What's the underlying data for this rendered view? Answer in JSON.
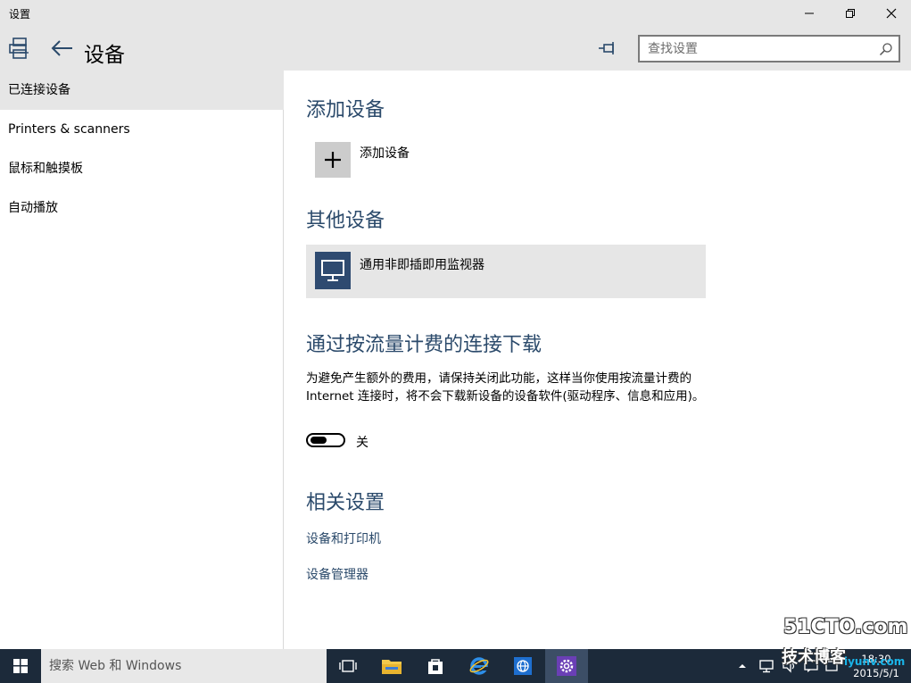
{
  "window": {
    "title": "设置"
  },
  "header": {
    "page_title": "设备",
    "search_placeholder": "查找设置"
  },
  "sidebar": {
    "items": [
      {
        "label": "已连接设备"
      },
      {
        "label": "Printers & scanners"
      },
      {
        "label": "鼠标和触摸板"
      },
      {
        "label": "自动播放"
      }
    ]
  },
  "main": {
    "add_section": {
      "heading": "添加设备",
      "button_label": "添加设备"
    },
    "other_section": {
      "heading": "其他设备",
      "device_name": "通用非即插即用监视器"
    },
    "metered_section": {
      "heading": "通过按流量计费的连接下载",
      "description": "为避免产生额外的费用，请保持关闭此功能，这样当你使用按流量计费的 Internet 连接时，将不会下载新设备的设备软件(驱动程序、信息和应用)。",
      "toggle_label": "关",
      "toggle_on": false
    },
    "related_section": {
      "heading": "相关设置",
      "links": [
        {
          "label": "设备和打印机"
        },
        {
          "label": "设备管理器"
        }
      ]
    }
  },
  "taskbar": {
    "search_text": "搜索 Web 和 Windows",
    "clock_time": "18:30",
    "clock_date": "2015/5/1",
    "apps": [
      "task-view",
      "file-explorer",
      "store",
      "internet-explorer",
      "network",
      "settings"
    ]
  },
  "watermark": {
    "brand": "51CTO.com",
    "subtitle": "技术博客",
    "site": "iyunv.com"
  },
  "colors": {
    "chrome_bg": "#e6e6e6",
    "heading": "#2b4a6b",
    "taskbar": "#1c2a3a",
    "monitor_tile": "#2e4a70"
  }
}
